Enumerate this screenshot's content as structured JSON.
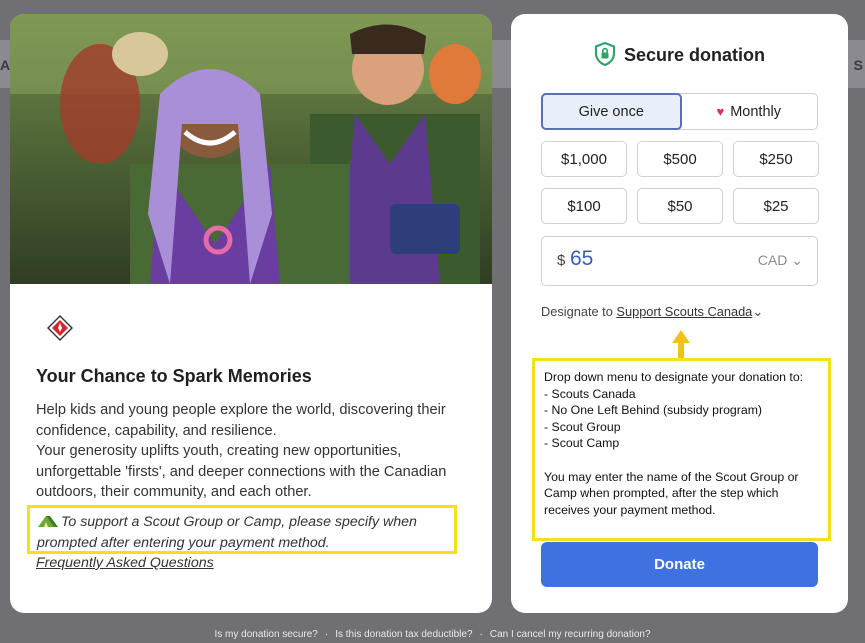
{
  "background": {
    "left_fragment": "A",
    "right_fragment": "S"
  },
  "story": {
    "title": "Your Chance to Spark Memories",
    "paragraph1": "Help kids and young people explore the world, discovering their confidence, capability, and resilience.",
    "paragraph2": "Your generosity uplifts youth, creating new opportunities, unforgettable 'firsts', and deeper connections with the Canadian outdoors, their community, and each other.",
    "note": "To support a Scout Group or Camp, please specify when prompted after entering your payment method.",
    "faq_link": "Frequently Asked Questions"
  },
  "form": {
    "title": "Secure donation",
    "frequency": {
      "give_once": "Give once",
      "monthly": "Monthly",
      "selected": "Give once"
    },
    "amounts": [
      "$1,000",
      "$500",
      "$250",
      "$100",
      "$50",
      "$25"
    ],
    "custom_amount": {
      "symbol": "$",
      "value": "65",
      "currency": "CAD"
    },
    "designate_prefix": "Designate to",
    "designate_value": "Support Scouts Canada",
    "donate_label": "Donate"
  },
  "callout": {
    "lines": [
      "Drop down menu to designate your donation to:",
      "- Scouts Canada",
      "- No One Left Behind (subsidy program)",
      "- Scout Group",
      "- Scout Camp",
      "",
      "You may enter the name of the Scout Group or Camp when prompted, after the step which receives your payment method."
    ]
  },
  "footer": {
    "links": [
      "Is my donation secure?",
      "Is this donation tax deductible?",
      "Can I cancel my recurring donation?"
    ],
    "separator": "·"
  },
  "colors": {
    "accent": "#3f72e0",
    "highlight": "#f2e11a",
    "secure_green": "#2ea36a",
    "heart": "#d9305d"
  }
}
